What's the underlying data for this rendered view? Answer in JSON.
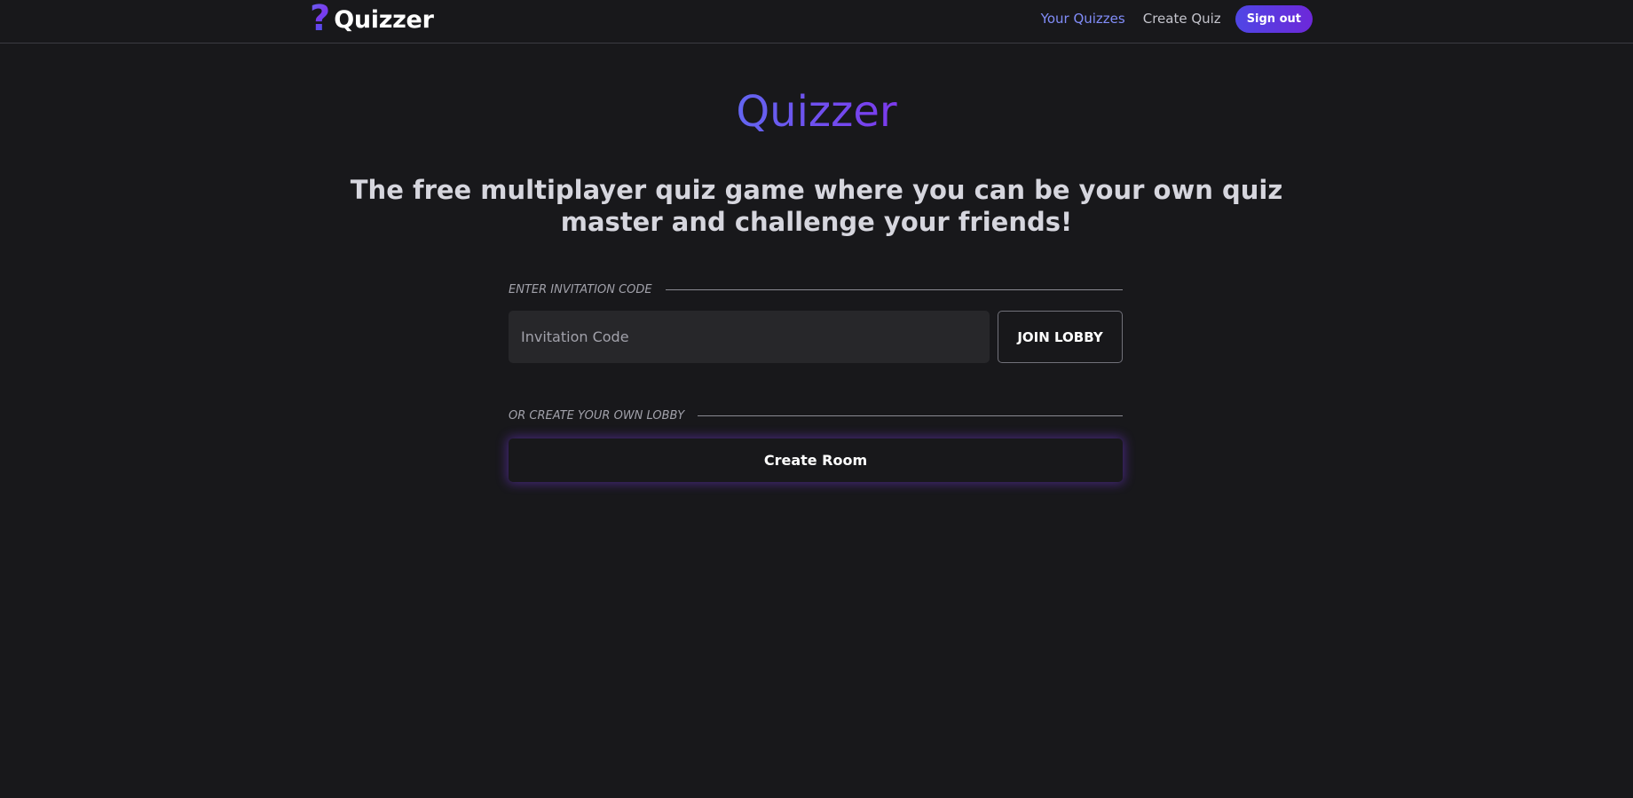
{
  "header": {
    "brand_icon": "?",
    "brand_name": "Quizzer",
    "nav": {
      "your_quizzes": "Your Quizzes",
      "create_quiz": "Create Quiz",
      "sign_out": "Sign out"
    }
  },
  "hero": {
    "title": "Quizzer",
    "tagline": "The free multiplayer quiz game where you can be your own quiz master and challenge your friends!"
  },
  "join": {
    "section_label": "ENTER INVITATION CODE",
    "input_value": "",
    "input_placeholder": "Invitation Code",
    "button_label": "JOIN LOBBY"
  },
  "create": {
    "section_label": "OR CREATE YOUR OWN LOBBY",
    "button_label": "Create Room"
  },
  "colors": {
    "background": "#18181b",
    "accent": "#6366f1",
    "accent_secondary": "#7c3aed",
    "active_link": "#818cf8"
  },
  "icons": {
    "brand": "question-mark-icon"
  }
}
